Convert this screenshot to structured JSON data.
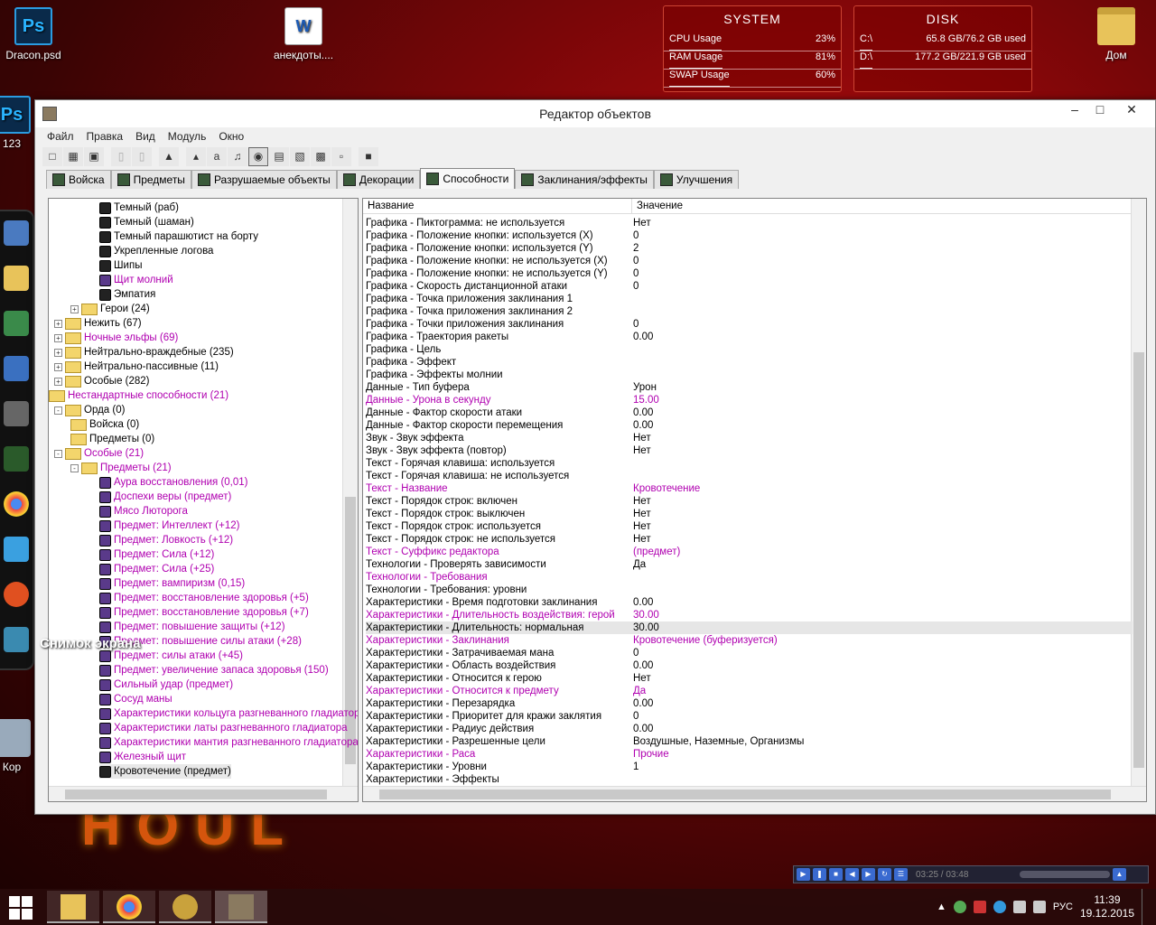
{
  "desktop": {
    "icons": [
      {
        "label": "Dracon.psd",
        "glyph": "Ps"
      },
      {
        "label": "анекдоты....",
        "glyph": "W"
      },
      {
        "label": "Дом",
        "glyph": "folder"
      }
    ],
    "partial_label_123": "123",
    "partial_label_kor": "Кор",
    "screenshot_text": "Снимок экрана",
    "wallpaper_text": "HOUL"
  },
  "widgets": {
    "system": {
      "title": "SYSTEM",
      "rows": [
        {
          "k": "CPU Usage",
          "v": "23%"
        },
        {
          "k": "RAM Usage",
          "v": "81%"
        },
        {
          "k": "SWAP Usage",
          "v": "60%"
        }
      ]
    },
    "disk": {
      "title": "DISK",
      "rows": [
        {
          "k": "C:\\",
          "v": "65.8 GB/76.2 GB used"
        },
        {
          "k": "D:\\",
          "v": "177.2 GB/221.9 GB used"
        }
      ]
    }
  },
  "window": {
    "title": "Редактор объектов",
    "menu": [
      "Файл",
      "Правка",
      "Вид",
      "Модуль",
      "Окно"
    ],
    "tabs": [
      {
        "label": "Войска",
        "active": false
      },
      {
        "label": "Предметы",
        "active": false
      },
      {
        "label": "Разрушаемые объекты",
        "active": false
      },
      {
        "label": "Декорации",
        "active": false
      },
      {
        "label": "Способности",
        "active": true
      },
      {
        "label": "Заклинания/эффекты",
        "active": false
      },
      {
        "label": "Улучшения",
        "active": false
      }
    ]
  },
  "tree": [
    {
      "label": "Темный (раб)",
      "lvl": 3,
      "type": "ability"
    },
    {
      "label": "Темный (шаман)",
      "lvl": 3,
      "type": "ability"
    },
    {
      "label": "Темный парашютист на борту",
      "lvl": 3,
      "type": "ability"
    },
    {
      "label": "Укрепленные логова",
      "lvl": 3,
      "type": "ability"
    },
    {
      "label": "Шипы",
      "lvl": 3,
      "type": "ability"
    },
    {
      "label": "Щит молний",
      "lvl": 3,
      "type": "ability",
      "m": true
    },
    {
      "label": "Эмпатия",
      "lvl": 3,
      "type": "ability"
    },
    {
      "label": "Герои (24)",
      "lvl": 2,
      "type": "folder",
      "exp": "+"
    },
    {
      "label": "Нежить (67)",
      "lvl": 1,
      "type": "folder",
      "exp": "+"
    },
    {
      "label": "Ночные эльфы (69)",
      "lvl": 1,
      "type": "folder",
      "exp": "+",
      "m": true
    },
    {
      "label": "Нейтрально-враждебные (235)",
      "lvl": 1,
      "type": "folder",
      "exp": "+"
    },
    {
      "label": "Нейтрально-пассивные (11)",
      "lvl": 1,
      "type": "folder",
      "exp": "+"
    },
    {
      "label": "Особые (282)",
      "lvl": 1,
      "type": "folder",
      "exp": "+"
    },
    {
      "label": "Нестандартные способности (21)",
      "lvl": 0,
      "type": "folder",
      "m": true
    },
    {
      "label": "Орда (0)",
      "lvl": 1,
      "type": "folder",
      "exp": "-"
    },
    {
      "label": "Войска (0)",
      "lvl": 2,
      "type": "folder"
    },
    {
      "label": "Предметы (0)",
      "lvl": 2,
      "type": "folder"
    },
    {
      "label": "Особые (21)",
      "lvl": 1,
      "type": "folder",
      "exp": "-",
      "m": true
    },
    {
      "label": "Предметы (21)",
      "lvl": 2,
      "type": "folder",
      "exp": "-",
      "m": true
    },
    {
      "label": "Аура восстановления (0,01)",
      "lvl": 3,
      "type": "ability",
      "m": true
    },
    {
      "label": "Доспехи веры (предмет)",
      "lvl": 3,
      "type": "ability",
      "m": true
    },
    {
      "label": "Мясо Люторога",
      "lvl": 3,
      "type": "ability",
      "m": true
    },
    {
      "label": "Предмет: Интеллект (+12)",
      "lvl": 3,
      "type": "ability",
      "m": true
    },
    {
      "label": "Предмет: Ловкость (+12)",
      "lvl": 3,
      "type": "ability",
      "m": true
    },
    {
      "label": "Предмет: Сила (+12)",
      "lvl": 3,
      "type": "ability",
      "m": true
    },
    {
      "label": "Предмет: Сила (+25)",
      "lvl": 3,
      "type": "ability",
      "m": true
    },
    {
      "label": "Предмет: вампиризм (0,15)",
      "lvl": 3,
      "type": "ability",
      "m": true
    },
    {
      "label": "Предмет: восстановление здоровья (+5)",
      "lvl": 3,
      "type": "ability",
      "m": true
    },
    {
      "label": "Предмет: восстановление здоровья (+7)",
      "lvl": 3,
      "type": "ability",
      "m": true
    },
    {
      "label": "Предмет: повышение защиты (+12)",
      "lvl": 3,
      "type": "ability",
      "m": true
    },
    {
      "label": "Предмет: повышение силы атаки (+28)",
      "lvl": 3,
      "type": "ability",
      "m": true
    },
    {
      "label": "Предмет: силы атаки (+45)",
      "lvl": 3,
      "type": "ability",
      "m": true
    },
    {
      "label": "Предмет: увеличение запаса здоровья (150)",
      "lvl": 3,
      "type": "ability",
      "m": true
    },
    {
      "label": "Сильный удар (предмет)",
      "lvl": 3,
      "type": "ability",
      "m": true
    },
    {
      "label": "Сосуд маны",
      "lvl": 3,
      "type": "ability",
      "m": true
    },
    {
      "label": "Характеристики кольцуга разгневанного гладиатора",
      "lvl": 3,
      "type": "ability",
      "m": true
    },
    {
      "label": "Характеристики латы разгневанного гладиатора",
      "lvl": 3,
      "type": "ability",
      "m": true
    },
    {
      "label": "Характеристики мантия разгневанного гладиатора",
      "lvl": 3,
      "type": "ability",
      "m": true
    },
    {
      "label": "Железный щит",
      "lvl": 3,
      "type": "ability",
      "m": true
    },
    {
      "label": "Кровотечение (предмет)",
      "lvl": 3,
      "type": "ability",
      "sel": true
    }
  ],
  "grid": {
    "col_name": "Название",
    "col_value": "Значение",
    "rows": [
      {
        "k": "Графика - Пиктограмма: не используется",
        "v": "Нет"
      },
      {
        "k": "Графика - Положение кнопки: используется (X)",
        "v": "0"
      },
      {
        "k": "Графика - Положение кнопки: используется (Y)",
        "v": "2"
      },
      {
        "k": "Графика - Положение кнопки: не используется (X)",
        "v": "0"
      },
      {
        "k": "Графика - Положение кнопки: не используется (Y)",
        "v": "0"
      },
      {
        "k": "Графика - Скорость дистанционной атаки",
        "v": "0"
      },
      {
        "k": "Графика - Точка приложения заклинания 1",
        "v": ""
      },
      {
        "k": "Графика - Точка приложения заклинания 2",
        "v": ""
      },
      {
        "k": "Графика - Точки приложения заклинания",
        "v": "0"
      },
      {
        "k": "Графика - Траектория ракеты",
        "v": "0.00"
      },
      {
        "k": "Графика - Цель",
        "v": ""
      },
      {
        "k": "Графика - Эффект",
        "v": ""
      },
      {
        "k": "Графика - Эффекты молнии",
        "v": ""
      },
      {
        "k": "Данные - Тип буфера",
        "v": "Урон"
      },
      {
        "k": "Данные - Урона в секунду",
        "v": "15.00",
        "m": true
      },
      {
        "k": "Данные - Фактор скорости атаки",
        "v": "0.00"
      },
      {
        "k": "Данные - Фактор скорости перемещения",
        "v": "0.00"
      },
      {
        "k": "Звук - Звук эффекта",
        "v": "Нет"
      },
      {
        "k": "Звук - Звук эффекта (повтор)",
        "v": "Нет"
      },
      {
        "k": "Текст - Горячая клавиша: используется",
        "v": ""
      },
      {
        "k": "Текст - Горячая клавиша: не используется",
        "v": ""
      },
      {
        "k": "Текст - Название",
        "v": "Кровотечение",
        "m": true
      },
      {
        "k": "Текст - Порядок строк: включен",
        "v": "Нет"
      },
      {
        "k": "Текст - Порядок строк: выключен",
        "v": "Нет"
      },
      {
        "k": "Текст - Порядок строк: используется",
        "v": "Нет"
      },
      {
        "k": "Текст - Порядок строк: не используется",
        "v": "Нет"
      },
      {
        "k": "Текст - Суффикс редактора",
        "v": "(предмет)",
        "m": true
      },
      {
        "k": "Технологии - Проверять зависимости",
        "v": "Да"
      },
      {
        "k": "Технологии - Требования",
        "v": "",
        "m": true
      },
      {
        "k": "Технологии - Требования: уровни",
        "v": ""
      },
      {
        "k": "Характеристики - Время подготовки заклинания",
        "v": "0.00"
      },
      {
        "k": "Характеристики - Длительность воздействия: герой",
        "v": "30.00",
        "m": true
      },
      {
        "k": "Характеристики - Длительность: нормальная",
        "v": "30.00",
        "sel": true
      },
      {
        "k": "Характеристики - Заклинания",
        "v": "Кровотечение (буферизуется)",
        "m": true
      },
      {
        "k": "Характеристики - Затрачиваемая мана",
        "v": "0"
      },
      {
        "k": "Характеристики - Область воздействия",
        "v": "0.00"
      },
      {
        "k": "Характеристики - Относится к герою",
        "v": "Нет"
      },
      {
        "k": "Характеристики - Относится к предмету",
        "v": "Да",
        "m": true
      },
      {
        "k": "Характеристики - Перезарядка",
        "v": "0.00"
      },
      {
        "k": "Характеристики - Приоритет для кражи заклятия",
        "v": "0"
      },
      {
        "k": "Характеристики - Радиус действия",
        "v": "0.00"
      },
      {
        "k": "Характеристики - Разрешенные цели",
        "v": "Воздушные, Наземные, Организмы"
      },
      {
        "k": "Характеристики - Раса",
        "v": "Прочие",
        "m": true
      },
      {
        "k": "Характеристики - Уровни",
        "v": "1"
      },
      {
        "k": "Характеристики - Эффекты",
        "v": ""
      }
    ]
  },
  "media": {
    "time": "03:25 / 03:48"
  },
  "taskbar": {
    "lang": "РУС",
    "time": "11:39",
    "date": "19.12.2015"
  },
  "colors": {
    "accent": "#b000b0",
    "window_bg": "#f0f0f0"
  }
}
